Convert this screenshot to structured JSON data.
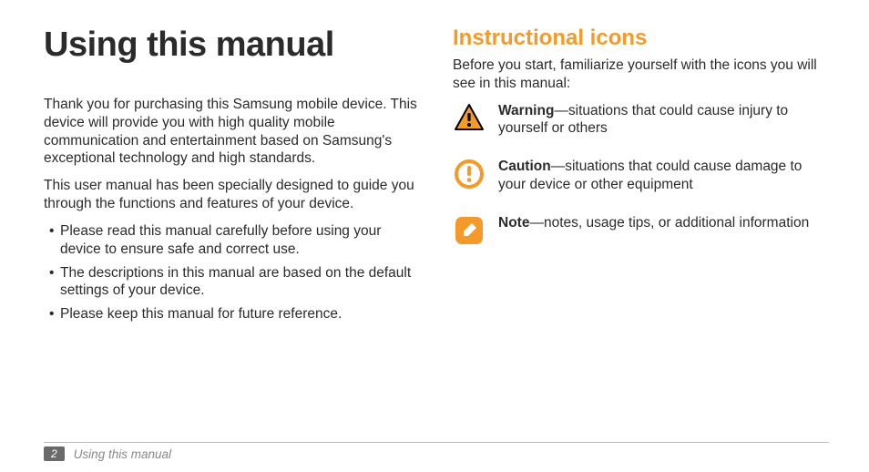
{
  "page": {
    "title": "Using this manual",
    "intro1": "Thank you for purchasing this Samsung mobile device. This device will provide you with high quality mobile communication and entertainment based on Samsung's exceptional technology and high standards.",
    "intro2": "This user manual has been specially designed to guide you through the functions and features of your device.",
    "bullets": [
      "Please read this manual carefully before using your device to ensure safe and correct use.",
      "The descriptions in this manual are based on the default settings of your device.",
      "Please keep this manual for future reference."
    ]
  },
  "icons_section": {
    "heading": "Instructional icons",
    "intro": "Before you start, familiarize yourself with the icons you will see in this manual:",
    "items": [
      {
        "icon": "warning-triangle-icon",
        "label": "Warning",
        "desc": "—situations that could cause injury to yourself or others"
      },
      {
        "icon": "caution-circle-icon",
        "label": "Caution",
        "desc": "—situations that could cause damage to your device or other equipment"
      },
      {
        "icon": "note-pencil-icon",
        "label": "Note",
        "desc": "—notes, usage tips, or additional information"
      }
    ]
  },
  "footer": {
    "page_number": "2",
    "running_title": "Using this manual"
  }
}
